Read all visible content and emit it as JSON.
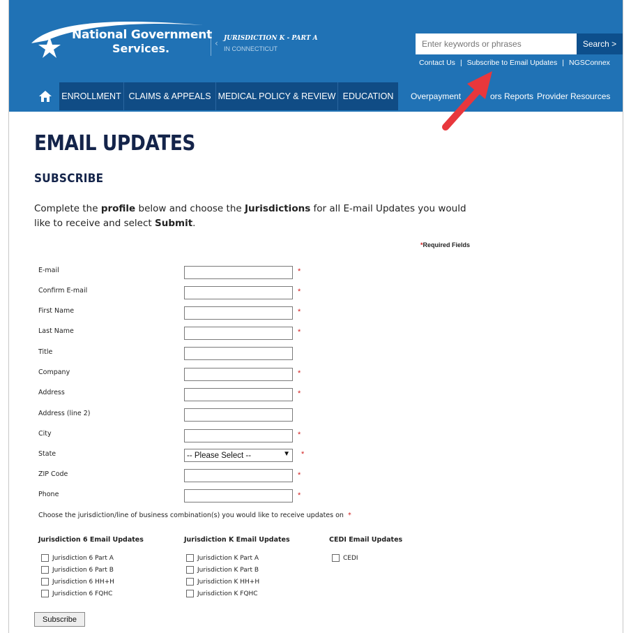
{
  "header": {
    "logo_line1": "National Government",
    "logo_line2": "Services.",
    "jurisdiction_title": "JURISDICTION K - PART A",
    "jurisdiction_sub": "IN CONNECTICUT",
    "search_placeholder": "Enter keywords or phrases",
    "search_button": "Search >",
    "utility_links": [
      "Contact Us",
      "Subscribe to Email Updates",
      "NGSConnex"
    ],
    "utility_separator": "|"
  },
  "nav": {
    "home_icon": "home-icon",
    "primary": [
      "ENROLLMENT",
      "CLAIMS & APPEALS",
      "MEDICAL POLICY & REVIEW",
      "EDUCATION"
    ],
    "secondary": [
      "Overpayment",
      "ors Reports",
      "Provider Resources"
    ]
  },
  "page": {
    "title": "EMAIL UPDATES",
    "subtitle": "SUBSCRIBE",
    "intro_parts": [
      "Complete the ",
      "profile",
      " below and choose the ",
      "Jurisdictions",
      " for all E-mail Updates you would like to receive and select ",
      "Submit",
      "."
    ],
    "required_star": "*",
    "required_note": "Required Fields"
  },
  "form": {
    "fields": [
      {
        "label": "E-mail",
        "required": "*"
      },
      {
        "label": "Confirm E-mail",
        "required": "*"
      },
      {
        "label": "First Name",
        "required": "*"
      },
      {
        "label": "Last Name",
        "required": "*"
      },
      {
        "label": "Title",
        "required": ""
      },
      {
        "label": "Company",
        "required": "*"
      },
      {
        "label": "Address",
        "required": "*"
      },
      {
        "label": "Address (line 2)",
        "required": ""
      },
      {
        "label": "City",
        "required": "*"
      },
      {
        "label": "State",
        "required": "*",
        "select_value": "-- Please Select --"
      },
      {
        "label": "ZIP Code",
        "required": "*"
      },
      {
        "label": "Phone",
        "required": "*"
      }
    ],
    "choose_text": "Choose the jurisdiction/line of business combination(s) you would like to receive updates on",
    "choose_star": "*",
    "columns": [
      {
        "heading": "Jurisdiction 6 Email Updates",
        "options": [
          "Jurisdiction 6 Part A",
          "Jurisdiction 6 Part B",
          "Jurisdiction 6 HH+H",
          "Jurisdiction 6 FQHC"
        ]
      },
      {
        "heading": "Jurisdiction K Email Updates",
        "options": [
          "Jurisdiction K Part A",
          "Jurisdiction K Part B",
          "Jurisdiction K HH+H",
          "Jurisdiction K FQHC"
        ]
      },
      {
        "heading": "CEDI Email Updates",
        "options": [
          "CEDI"
        ]
      }
    ],
    "submit_label": "Subscribe"
  },
  "annotation": {
    "color": "#e8373c"
  }
}
